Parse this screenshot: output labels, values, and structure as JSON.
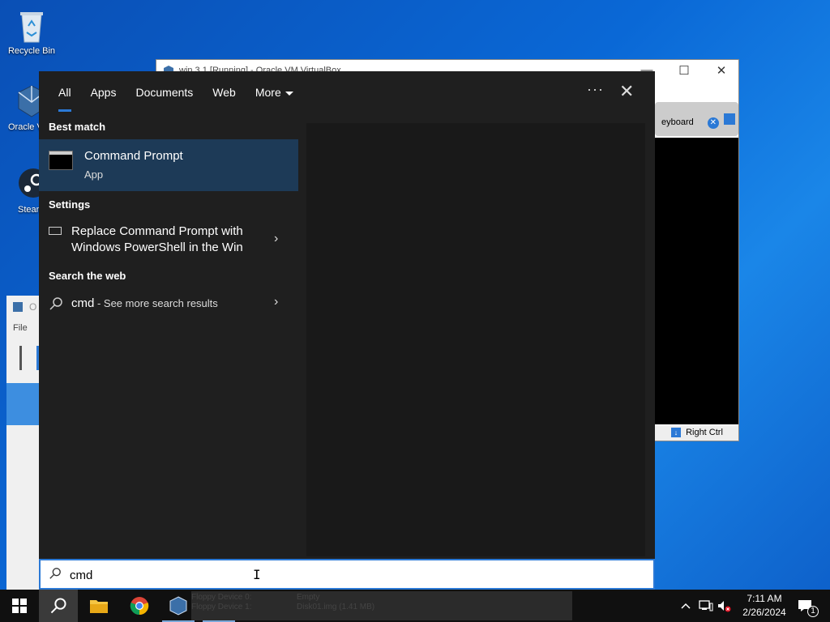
{
  "desktop": {
    "icons": [
      {
        "label": "Recycle Bin"
      },
      {
        "label": "Oracle VM VirtualBox"
      },
      {
        "label": "Steam"
      }
    ]
  },
  "vbox_window": {
    "title": "win 3.1 [Running] - Oracle VM VirtualBox",
    "toolbar_label": "eyboard",
    "status_label": "Right Ctrl"
  },
  "vbox_manager": {
    "title_fragment": "O",
    "file_menu": "File"
  },
  "search_panel": {
    "tabs": [
      {
        "label": "All",
        "active": true
      },
      {
        "label": "Apps"
      },
      {
        "label": "Documents"
      },
      {
        "label": "Web"
      },
      {
        "label": "More"
      }
    ],
    "sections": {
      "best_match": "Best match",
      "settings": "Settings",
      "search_web": "Search the web"
    },
    "best_match": {
      "name": "Command Prompt",
      "type": "App"
    },
    "settings_item": {
      "line1": "Replace Command Prompt with",
      "line2": "Windows PowerShell in the Win"
    },
    "web_item": {
      "query": "cmd",
      "suffix": " - See more search results"
    }
  },
  "search_box": {
    "value": "cmd"
  },
  "taskbar": {
    "ghost_text_1": "Floppy Device 0:",
    "ghost_text_2": "Floppy Device 1:",
    "ghost_text_3": "Empty",
    "ghost_text_4": "Disk01.img (1.41 MB)",
    "time": "7:11 AM",
    "date": "2/26/2024",
    "notification_count": "1"
  },
  "colors": {
    "accent": "#2b79d6",
    "panel": "#1f1f1f",
    "best_match_bg": "#1d3a57"
  }
}
